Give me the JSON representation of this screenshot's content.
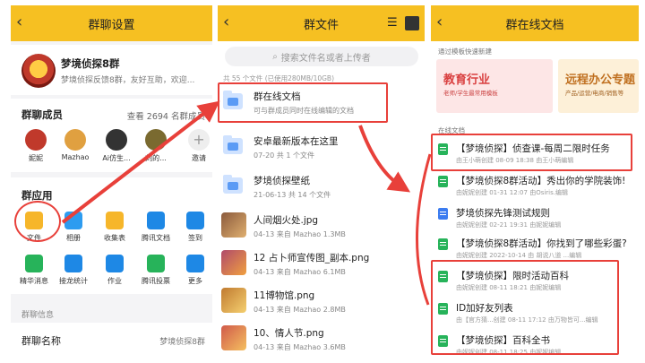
{
  "colors": {
    "topbar": "#f6c022",
    "annotation": "#e8403a",
    "folder": "#5b9bf5",
    "sheet": "#27b35a",
    "doc": "#3c7cf0"
  },
  "panel1": {
    "title": "群聊设置",
    "group": {
      "name": "梦境侦探8群",
      "desc": "梦境侦探反馈8群，友好互助，欢迎..."
    },
    "members": {
      "title": "群聊成员",
      "link": "查看 2694 名群成员",
      "items": [
        {
          "name": "妮妮",
          "color": "#c0392b"
        },
        {
          "name": "Mazhao",
          "color": "#e0a040"
        },
        {
          "name": "Ai仿生...",
          "color": "#333333"
        },
        {
          "name": "刘的...",
          "color": "#7a6a30"
        },
        {
          "name": "邀请",
          "color": "#dddddd"
        }
      ]
    },
    "apps": {
      "title": "群应用",
      "items": [
        {
          "name": "文件",
          "icon": "folder-icon",
          "color": "#f6b62a"
        },
        {
          "name": "相册",
          "icon": "album-icon",
          "color": "#2d9cf0"
        },
        {
          "name": "收集表",
          "icon": "form-icon",
          "color": "#f6b62a"
        },
        {
          "name": "腾讯文档",
          "icon": "tencent-docs-icon",
          "color": "#1e88e5"
        },
        {
          "name": "签到",
          "icon": "checkin-icon",
          "color": "#1e88e5"
        },
        {
          "name": "精华消息",
          "icon": "essence-icon",
          "color": "#27b35a"
        },
        {
          "name": "接龙统计",
          "icon": "relay-icon",
          "color": "#1e88e5"
        },
        {
          "name": "作业",
          "icon": "homework-icon",
          "color": "#1e88e5"
        },
        {
          "name": "腾讯投票",
          "icon": "vote-icon",
          "color": "#27b35a"
        },
        {
          "name": "更多",
          "icon": "more-icon",
          "color": "#1e88e5"
        }
      ]
    },
    "info": {
      "section": "群聊信息",
      "name_label": "群聊名称",
      "name_value": "梦境侦探8群"
    }
  },
  "panel2": {
    "title": "群文件",
    "search_placeholder": "搜索文件名或者上传者",
    "meta": "共 55 个文件 (已使用280MB/10GB)",
    "files": [
      {
        "name": "群在线文档",
        "sub": "可与群成员同时在线编辑的文档",
        "type": "folder"
      },
      {
        "name": "安卓最新版本在这里",
        "sub": "07-20 共 1 个文件",
        "type": "folder"
      },
      {
        "name": "梦境侦探壁纸",
        "sub": "21-06-13 共 14 个文件",
        "type": "folder"
      },
      {
        "name": "人间烟火处.jpg",
        "sub": "04-13 来自 Mazhao 1.3MB",
        "type": "image",
        "color": "#8b5a3c"
      },
      {
        "name": "12 占卜师宣传图_副本.png",
        "sub": "04-13 来自 Mazhao 6.1MB",
        "type": "image",
        "color": "#b04a6a"
      },
      {
        "name": "11博物馆.png",
        "sub": "04-13 来自 Mazhao 2.8MB",
        "type": "image",
        "color": "#c07a30"
      },
      {
        "name": "10、情人节.png",
        "sub": "04-13 来自 Mazhao 3.6MB",
        "type": "image",
        "color": "#d05a4a"
      }
    ]
  },
  "panel3": {
    "title": "群在线文档",
    "template_hint": "通过模板快速新建",
    "templates": [
      {
        "title": "教育行业",
        "sub": "老师/学生最常用模板",
        "bg": "#fde6e6",
        "color": "#d94040"
      },
      {
        "title": "远程办公专题",
        "sub": "产品/运营/电商/销售等",
        "bg": "#fdf0d8",
        "color": "#c07020"
      }
    ],
    "section": "在线文档",
    "docs": [
      {
        "title": "【梦境侦探】侦查课-每周二限时任务",
        "sub": "由王小萌创建 08-09 18:38 由王小萌编辑",
        "kind": "sheet"
      },
      {
        "title": "【梦境侦探8群活动】秀出你的学院装饰!",
        "sub": "由妮妮创建 01-31 12:07 由Osiris.编辑",
        "kind": "sheet"
      },
      {
        "title": "梦境侦探先锋测试规则",
        "sub": "由妮妮创建 02-21 19:31 由妮妮编辑",
        "kind": "doc"
      },
      {
        "title": "【梦境侦探8群活动】你找到了哪些彩蛋?",
        "sub": "由妮妮创建 2022-10-14 由 胡说八道 ...编辑",
        "kind": "sheet"
      },
      {
        "title": "【梦境侦探】限时活动百科",
        "sub": "由妮妮创建 08-11 18:21 由妮妮编辑",
        "kind": "sheet"
      },
      {
        "title": "ID加好友列表",
        "sub": "由【官方猜...创建 08-11 17:12 由万物皆可...编辑",
        "kind": "sheet"
      },
      {
        "title": "【梦境侦探】百科全书",
        "sub": "由妮妮创建 08-11 18:25 由妮妮编辑",
        "kind": "sheet"
      }
    ]
  }
}
